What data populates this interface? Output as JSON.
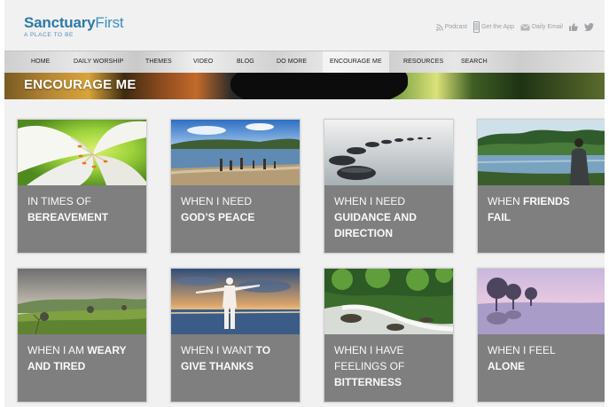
{
  "header": {
    "logo_main": "Sanctuary",
    "logo_accent": "First",
    "logo_sub": "A PLACE TO BE",
    "links": [
      {
        "icon": "rss-icon",
        "label": "Podcast"
      },
      {
        "icon": "phone-icon",
        "label": "Get the App"
      },
      {
        "icon": "mail-icon",
        "label": "Daily Email"
      },
      {
        "icon": "thumbs-up-icon",
        "label": ""
      },
      {
        "icon": "twitter-icon",
        "label": ""
      }
    ]
  },
  "nav": {
    "items": [
      "HOME",
      "DAILY WORSHIP",
      "THEMES",
      "VIDEO",
      "BLOG",
      "DO MORE",
      "ENCOURAGE ME",
      "RESOURCES",
      "SEARCH"
    ],
    "active": "ENCOURAGE ME"
  },
  "banner": {
    "title": "ENCOURAGE ME"
  },
  "cards": [
    {
      "line1": "IN TIMES OF",
      "bold1": "BEREAVEMENT",
      "photo": "white-lily"
    },
    {
      "line1": "WHEN I NEED",
      "bold1": "GOD’S PEACE",
      "photo": "lake-shore-posts"
    },
    {
      "line1": "WHEN I NEED",
      "bold1": "GUIDANCE AND",
      "bold2": "DIRECTION",
      "photo": "stepping-stones"
    },
    {
      "pre": "WHEN ",
      "bold_inline": "FRIENDS",
      "bold1": "FAIL",
      "photo": "man-by-lake"
    },
    {
      "pre": "WHEN I AM ",
      "bold_inline": "WEARY",
      "bold1": "AND TIRED",
      "photo": "hazy-meadow"
    },
    {
      "pre": "WHEN I WANT ",
      "bold_inline": "TO",
      "bold1": "GIVE THANKS",
      "photo": "man-arms-outstretched"
    },
    {
      "line1": "WHEN I HAVE",
      "line2": "FEELINGS OF",
      "bold1": "BITTERNESS",
      "photo": "river-rapids"
    },
    {
      "line1": "WHEN I FEEL",
      "bold1": "ALONE",
      "photo": "misty-lake-trees"
    }
  ]
}
